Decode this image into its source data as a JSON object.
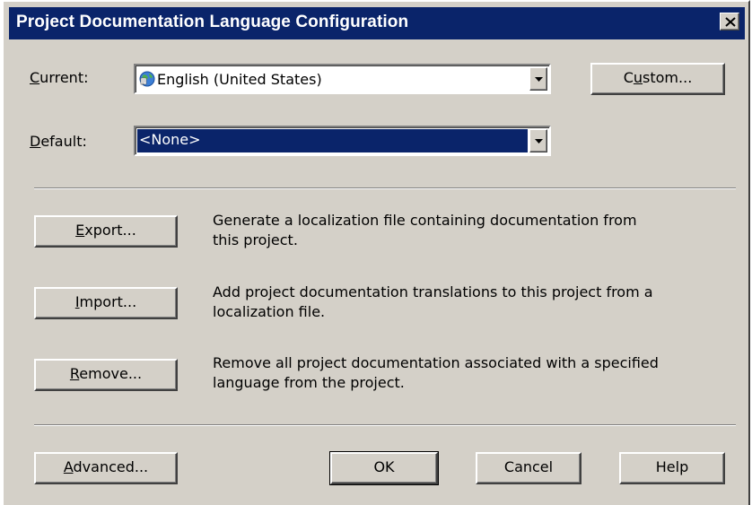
{
  "window": {
    "title": "Project Documentation Language Configuration"
  },
  "current": {
    "label_accel": "C",
    "label_rest": "urrent:",
    "value": "English (United States)"
  },
  "default": {
    "label_accel": "D",
    "label_rest": "efault:",
    "value": "<None>"
  },
  "custom_button": {
    "pre": "C",
    "accel": "u",
    "post": "stom..."
  },
  "actions": [
    {
      "accel": "E",
      "rest": "xport...",
      "description": "Generate a localization file containing documentation from this project."
    },
    {
      "accel": "I",
      "rest": "mport...",
      "description": "Add project documentation translations to this project from a localization file."
    },
    {
      "accel": "R",
      "rest": "emove...",
      "description": "Remove all project documentation associated with a specified language from the project."
    }
  ],
  "footer": {
    "advanced": {
      "accel": "A",
      "rest": "dvanced..."
    },
    "ok": "OK",
    "cancel": "Cancel",
    "help": "Help"
  },
  "icons": {
    "close": "close-icon",
    "dropdown": "dropdown-arrow-icon",
    "language": "globe-language-icon"
  },
  "colors": {
    "face": "#d4d0c8",
    "titlebar": "#0a246a",
    "selection": "#0a246a"
  }
}
